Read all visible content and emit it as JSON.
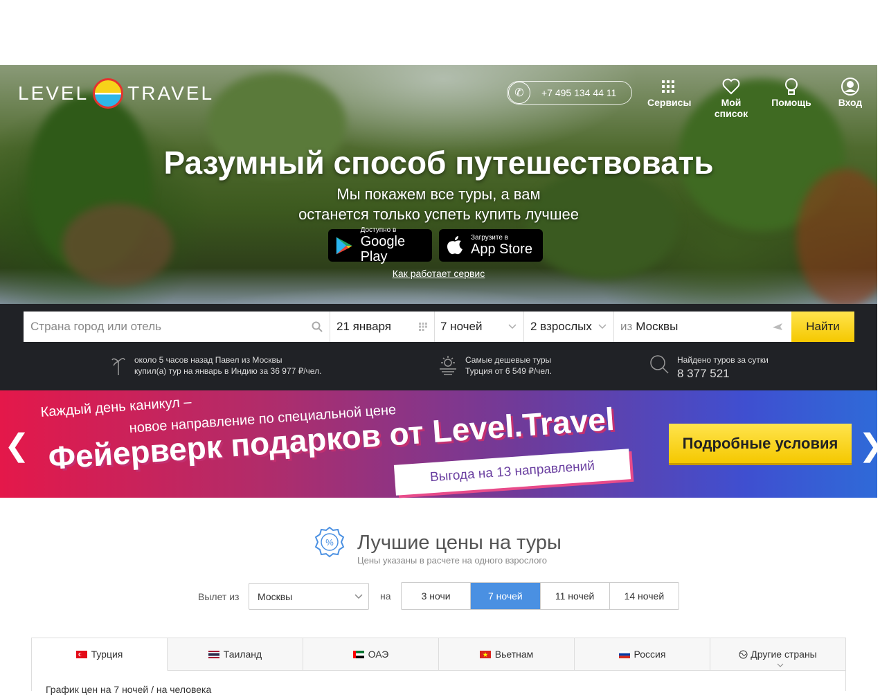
{
  "header": {
    "logo_left": "LEVEL",
    "logo_right": "TRAVEL",
    "phone": "+7 495 134 44 11",
    "nav": [
      {
        "label": "Сервисы",
        "icon": "grid-icon"
      },
      {
        "label": "Мой список",
        "icon": "heart-icon"
      },
      {
        "label": "Помощь",
        "icon": "bulb-icon"
      },
      {
        "label": "Вход",
        "icon": "user-icon"
      }
    ]
  },
  "hero": {
    "title": "Разумный способ путешествовать",
    "subtitle_line1": "Мы покажем все туры, а вам",
    "subtitle_line2": "останется только успеть купить лучшее",
    "google_small": "Доступно в",
    "google_big": "Google Play",
    "apple_small": "Загрузите в",
    "apple_big": "App Store",
    "how_link": "Как работает сервис"
  },
  "search": {
    "destination_placeholder": "Страна город или отель",
    "date": "21 января",
    "nights": "7 ночей",
    "adults": "2 взрослых",
    "from_prefix": "из",
    "from_city": "Москвы",
    "find_label": "Найти"
  },
  "info": {
    "recent_line1": "около 5 часов назад Павел из Москвы",
    "recent_line2": "купил(а) тур на январь в Индию за 36 977 ₽/чел.",
    "cheap_line1": "Самые дешевые туры",
    "cheap_line2": "Турция от 6 549 ₽/чел.",
    "found_label": "Найдено туров за сутки",
    "found_count": "8 377 521"
  },
  "promo": {
    "line1": "Каждый день каникул –",
    "line2": "новое направление по специальной цене",
    "title": "Фейерверк подарков от Level.Travel",
    "badge": "Выгода на 13 направлений",
    "button": "Подробные условия"
  },
  "best_prices": {
    "title": "Лучшие цены на туры",
    "subtitle": "Цены указаны в расчете на одного взрослого",
    "departure_label": "Вылет из",
    "departure_value": "Москвы",
    "nights_label": "на",
    "nights_options": [
      "3 ночи",
      "7 ночей",
      "11 ночей",
      "14 ночей"
    ],
    "nights_selected_index": 1,
    "tabs": [
      {
        "label": "Турция",
        "flag": "turkey-flag"
      },
      {
        "label": "Таиланд",
        "flag": "thailand-flag"
      },
      {
        "label": "ОАЭ",
        "flag": "uae-flag"
      },
      {
        "label": "Вьетнам",
        "flag": "vietnam-flag"
      },
      {
        "label": "Россия",
        "flag": "russia-flag"
      },
      {
        "label": "Другие страны",
        "flag": "globe-icon"
      }
    ],
    "chart_caption": "График цен на 7 ночей / на человека"
  },
  "colors": {
    "accent_yellow": "#f5c800",
    "accent_blue": "#4a90e2",
    "dark_band": "#202226"
  }
}
